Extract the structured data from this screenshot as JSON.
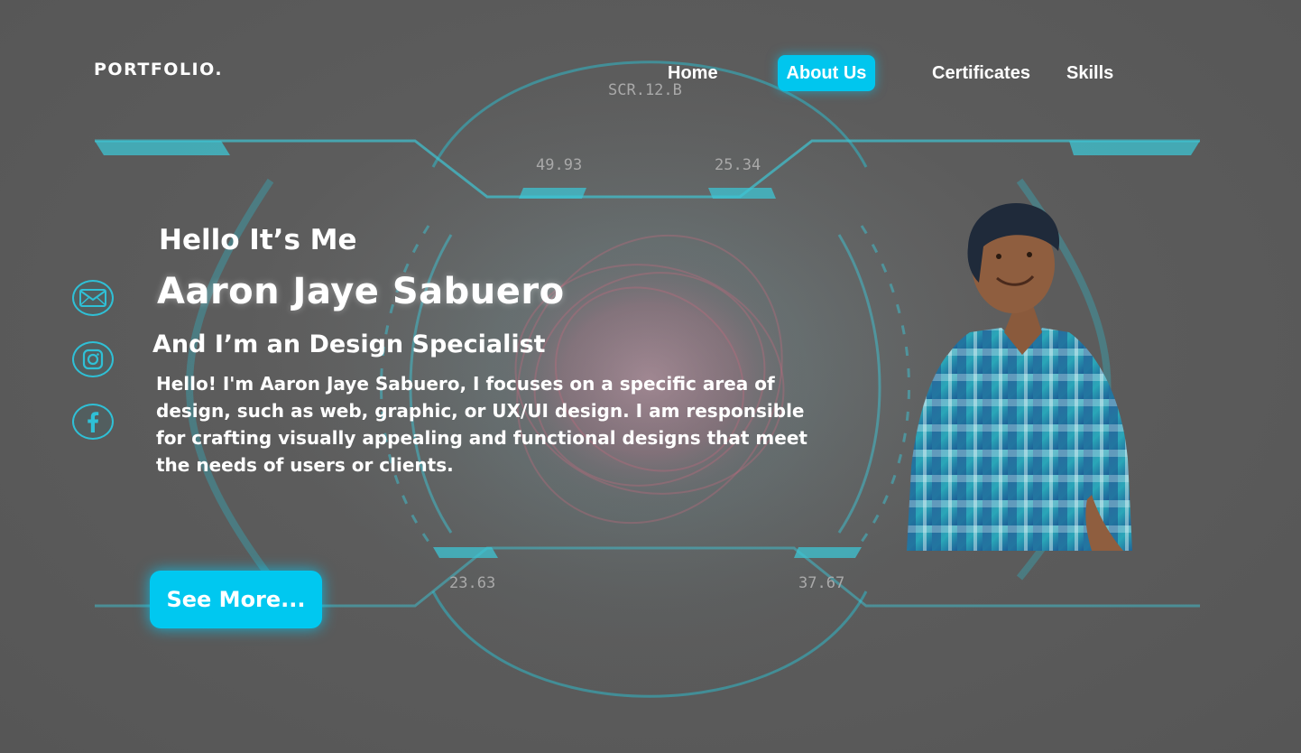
{
  "header": {
    "brand": "PORTFOLIO.",
    "nav": [
      {
        "label": "Home",
        "active": false
      },
      {
        "label": "About Us",
        "active": true
      },
      {
        "label": "Certificates",
        "active": false
      },
      {
        "label": "Skills",
        "active": false
      }
    ]
  },
  "hud_labels": {
    "top": "SCR.12.B",
    "upper_left": "49.93",
    "upper_right": "25.34",
    "lower_left": "23.63",
    "lower_right": "37.67"
  },
  "hero": {
    "greeting": "Hello It’s Me",
    "name": "Aaron Jaye Sabuero",
    "role": "And I’m an Design Specialist",
    "bio": "Hello! I'm Aaron Jaye Sabuero, I focuses on a specific area of design, such as web, graphic, or UX/UI design. I am responsible for crafting visually appealing and functional designs that meet the needs of users or clients.",
    "cta_label": "See More..."
  },
  "social": [
    {
      "icon": "mail-icon"
    },
    {
      "icon": "instagram-icon"
    },
    {
      "icon": "facebook-icon"
    }
  ],
  "colors": {
    "accent": "#00c6ee",
    "hud_line": "#2fb8c8",
    "background": "#595959"
  }
}
